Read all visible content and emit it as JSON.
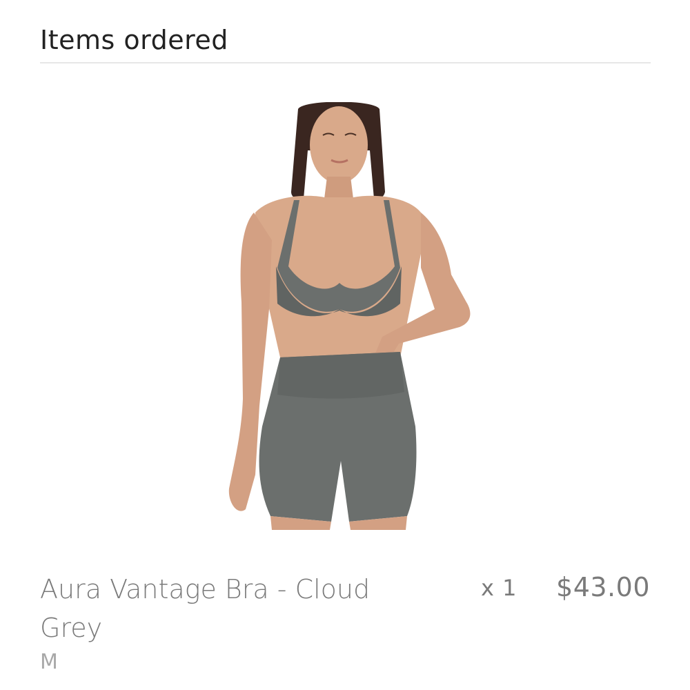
{
  "section": {
    "title": "Items ordered"
  },
  "item": {
    "image_alt": "Aura Vantage Bra - Cloud Grey product photo",
    "name": "Aura Vantage Bra - Cloud Grey",
    "variant": "M",
    "quantity": "x 1",
    "price": "$43.00"
  },
  "colors": {
    "title_text": "#222222",
    "body_text": "#7a7a7a",
    "muted_text": "#a8a8a8",
    "divider": "#e6e6e6",
    "garment": "#6b6f6d",
    "skin": "#d9a98a",
    "hair": "#3a2620"
  }
}
